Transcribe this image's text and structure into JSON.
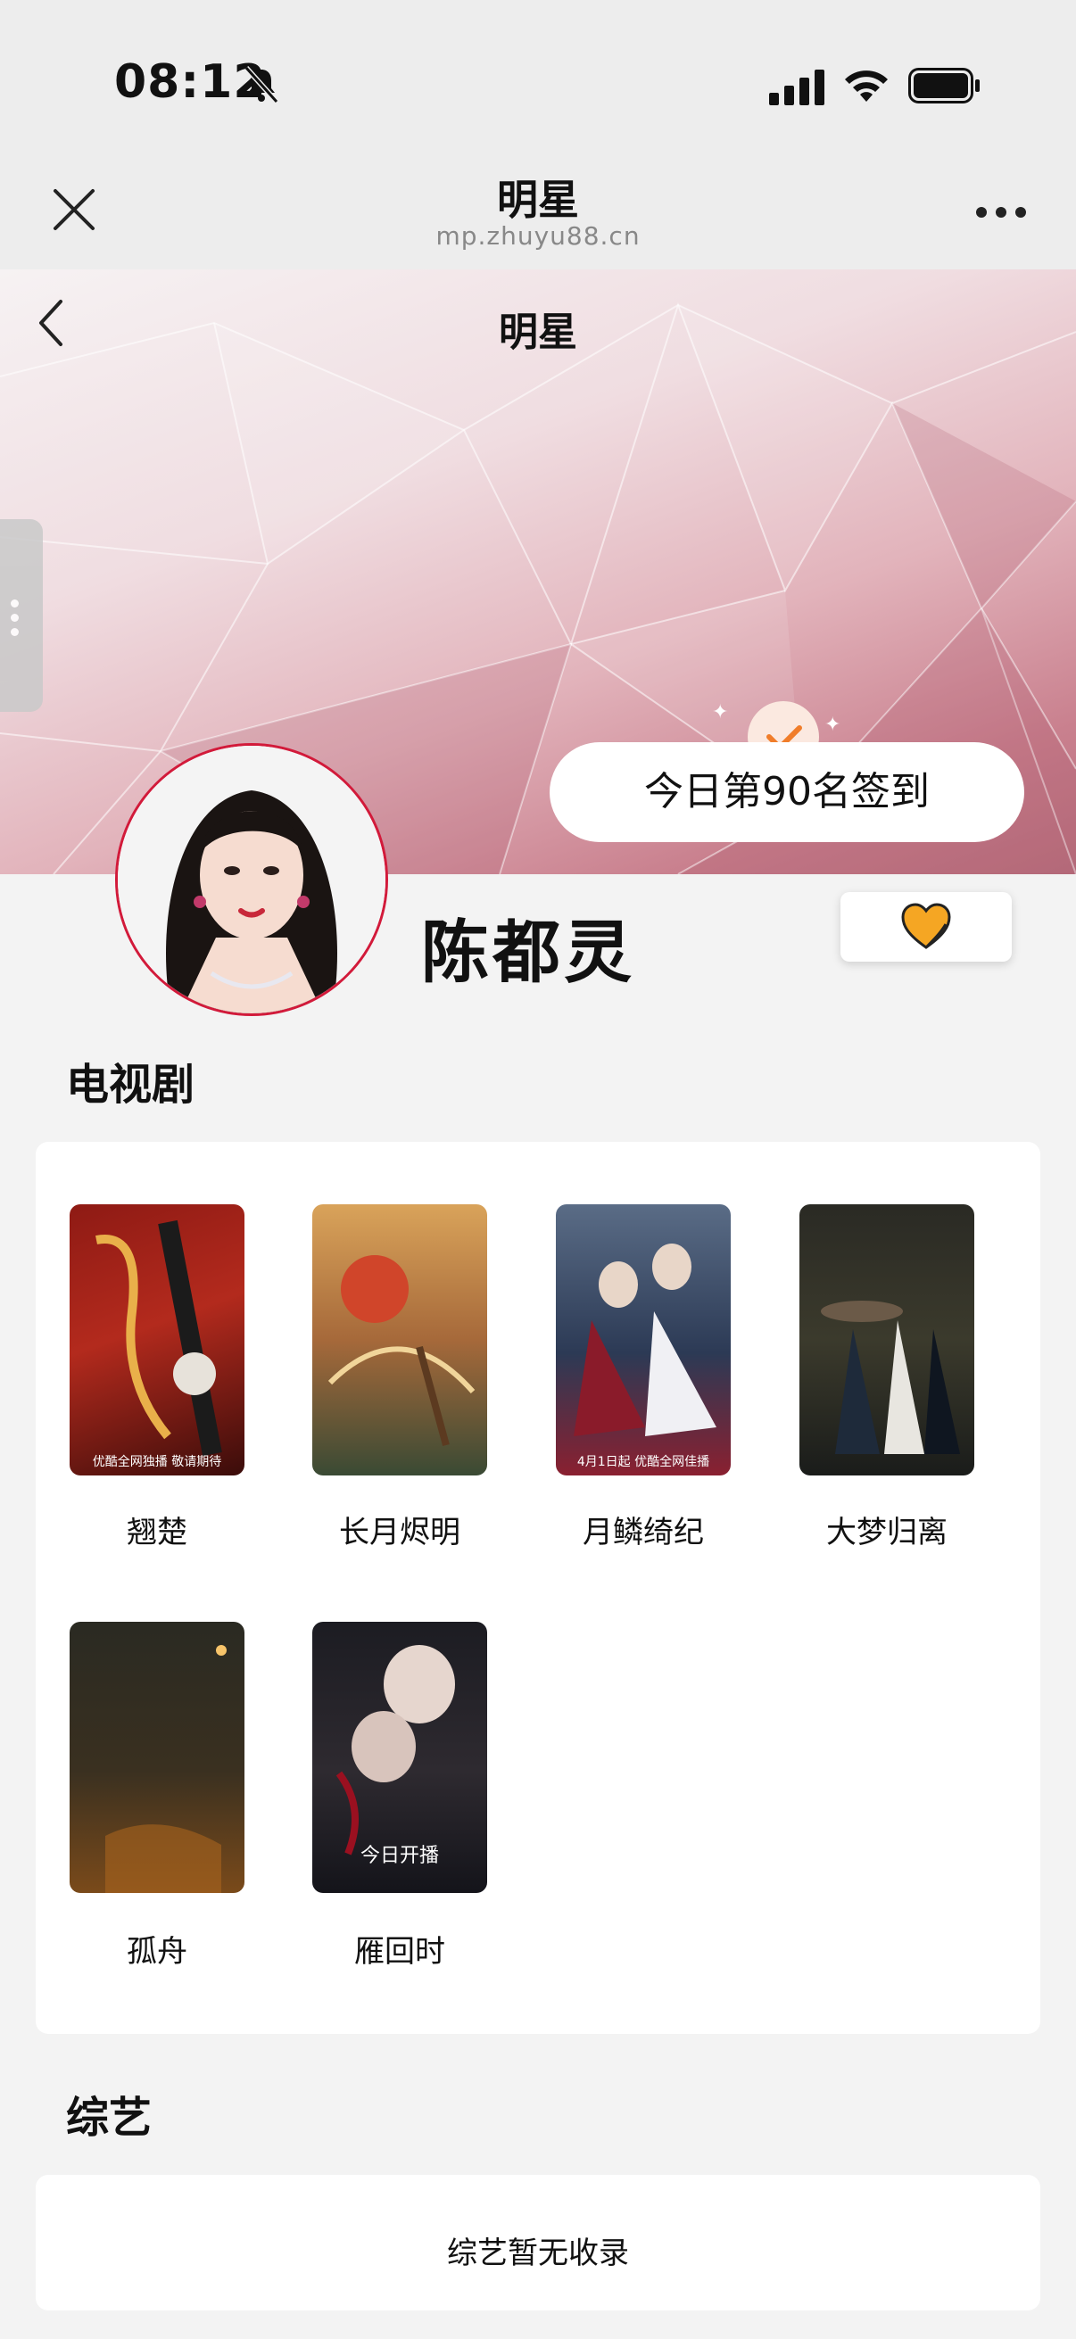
{
  "status_bar": {
    "time": "08:12"
  },
  "mini_program": {
    "title": "明星",
    "domain": "mp.zhuyu88.cn"
  },
  "page": {
    "title": "明星"
  },
  "checkin": {
    "text": "今日第90名签到"
  },
  "star": {
    "name": "陈都灵"
  },
  "tv_section": {
    "title": "电视剧",
    "items": [
      {
        "label": "翘楚",
        "caption": "优酷全网独播 敬请期待"
      },
      {
        "label": "长月烬明",
        "caption": ""
      },
      {
        "label": "月鳞绮纪",
        "caption": "4月1日起 优酷全网佳播"
      },
      {
        "label": "大梦归离",
        "caption": ""
      },
      {
        "label": "孤舟",
        "caption": ""
      },
      {
        "label": "雁回时",
        "caption": "今日开播"
      }
    ]
  },
  "variety_section": {
    "title": "综艺",
    "empty_text": "综艺暂无收录"
  },
  "colors": {
    "accent_red": "#d21a3a",
    "heart_orange": "#f5a623",
    "check_orange": "#f07d2a"
  },
  "icons": [
    "bell-slash-icon",
    "signal-icon",
    "wifi-icon",
    "battery-icon",
    "close-icon",
    "more-icon",
    "back-icon",
    "check-icon",
    "heart-icon"
  ]
}
